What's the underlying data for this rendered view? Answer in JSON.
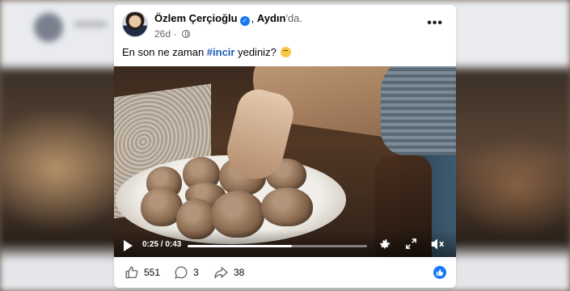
{
  "post": {
    "author_name": "Özlem Çerçioğlu",
    "location_name": "Aydın",
    "location_suffix": "'da.",
    "time_ago": "26d",
    "text_prefix": "En son ne zaman ",
    "hashtag": "#incir",
    "text_suffix": " yediniz?",
    "emoji": "thinking-face"
  },
  "video": {
    "time_display": "0:25 / 0:43",
    "progress": 0.58
  },
  "footer": {
    "likes_count": "551",
    "comments_count": "3",
    "shares_count": "38"
  },
  "colors": {
    "accent": "#1877f2",
    "hashtag": "#1a5fb4"
  }
}
